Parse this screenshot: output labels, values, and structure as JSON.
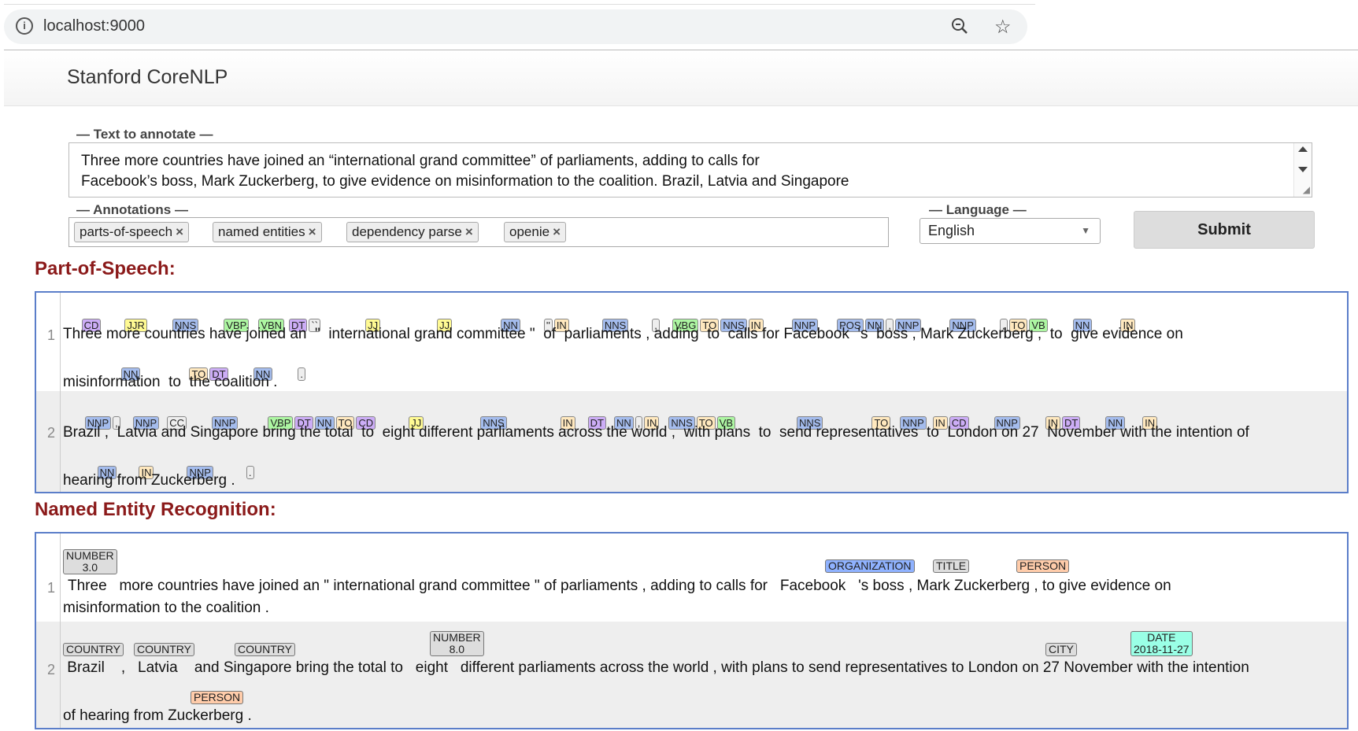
{
  "browser": {
    "url": "localhost:9000"
  },
  "app": {
    "title": "Stanford CoreNLP"
  },
  "form": {
    "text_legend": "— Text to annotate —",
    "text_lines": [
      "Three more countries have joined an “international grand committee” of parliaments, adding to calls for",
      "Facebook’s boss, Mark Zuckerberg, to give evidence on misinformation to the coalition. Brazil, Latvia and Singapore"
    ],
    "annotations_legend": "— Annotations —",
    "annotations": [
      "parts-of-speech",
      "named entities",
      "dependency parse",
      "openie"
    ],
    "language_legend": "— Language —",
    "language_value": "English",
    "submit_label": "Submit"
  },
  "pos": {
    "title": "Part-of-Speech:",
    "sentences": [
      {
        "num": "1",
        "line1_tags": "CD  JJR  NNS  VBP  VBN  DT  ``  JJ   JJ    NN  ''  IN  NNS  ,  VBG  TO  NNS  IN  NNP  POS  NN  ,  NNP  NNP  ,  TO  VB  NN  IN",
        "line1": "Three more countries have joined an  \"  international grand committee \"  of  parliaments , adding  to  calls for Facebook  's  boss , Mark Zuckerberg ,  to  give evidence on",
        "line2_tags": "NN  TO  DT  NN  .",
        "line2": "misinformation  to  the coalition ."
      },
      {
        "num": "2",
        "line1_tags": "NNP  ,  NNP  CC  NNP  VBP  DT  NN  TO  CD  JJ  NNS  IN  DT  NN  ,  IN  NNS  TO  VB  NNS  TO  NNP  IN  CD  NNP  IN  DT  NN  IN",
        "line1": "Brazil ,  Latvia and Singapore bring the total  to  eight different parliaments across the world ,  with plans  to  send representatives  to  London on 27  November with the intention of",
        "line2_tags": "NN  IN  NNP  .",
        "line2": "hearing from Zuckerberg ."
      }
    ]
  },
  "ner": {
    "title": "Named Entity Recognition:",
    "sentences": [
      {
        "num": "1",
        "line1": "Three   more countries have joined an \" international grand committee \" of parliaments , adding to calls for   Facebook   's boss , Mark Zuckerberg , to give evidence on",
        "line2": "misinformation to the coalition ."
      },
      {
        "num": "2",
        "line1": " Brazil    ,   Latvia    and Singapore bring the total to   eight   different parliaments across the world , with plans to send representatives to London on 27 November with the intention",
        "line2": "of hearing from Zuckerberg ."
      }
    ],
    "entities": {
      "number1": "NUMBER",
      "number1_val": "3.0",
      "organization": "ORGANIZATION",
      "title": "TITLE",
      "person1": "PERSON",
      "country1": "COUNTRY",
      "country2": "COUNTRY",
      "country3": "COUNTRY",
      "number2": "NUMBER",
      "number2_val": "8.0",
      "city": "CITY",
      "date": "DATE",
      "date_val": "2018-11-27",
      "person2": "PERSON"
    }
  },
  "colors": {
    "section_title": "#8b1a1a",
    "panel_border": "#5b7ec9",
    "tag_nn": "#a4bced",
    "tag_vb": "#adf6a2",
    "tag_jj": "#fffa93",
    "tag_in": "#ffe8be",
    "tag_cd": "#ccadf6",
    "tag_person": "#ffccaa",
    "tag_org": "#8fb2ff",
    "tag_date": "#9affe6"
  }
}
